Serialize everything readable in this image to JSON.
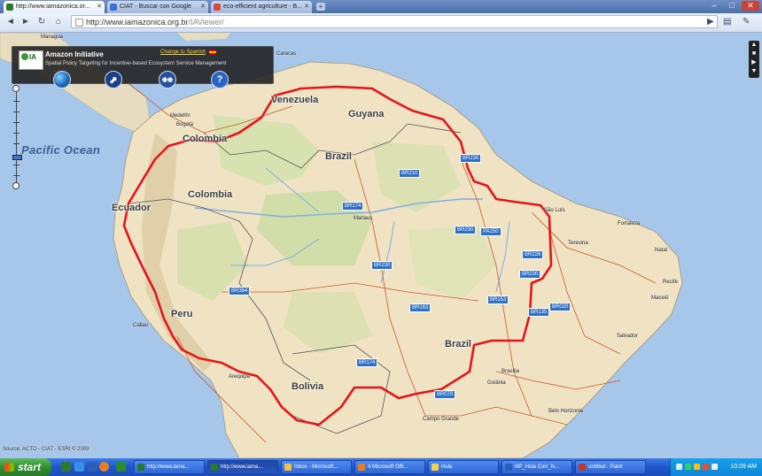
{
  "browser": {
    "tabs": [
      {
        "label": "http://www.iamazonica.or...",
        "active": true,
        "favicon_color": "#2a7a2a"
      },
      {
        "label": "CIAT - Buscar con Google",
        "active": false,
        "favicon_color": "#3b6fd8"
      },
      {
        "label": "eco-efficient agriculture - B...",
        "active": false,
        "favicon_color": "#d84a3b"
      }
    ],
    "new_tab": "+",
    "url_host": "http://www.iamazonica.org.br",
    "url_path": "/IAViewer/",
    "buttons": {
      "back": "◄",
      "forward": "►",
      "reload": "↻",
      "home": "⌂"
    }
  },
  "panel": {
    "title": "Amazon Initiative",
    "subtitle": "Spatial Policy Targeting for Incentive-based Ecosystem Service Management",
    "language_link": "Change to Spanish",
    "logo_text": "IA",
    "buttons": [
      {
        "name": "globe-icon",
        "glyph": "",
        "color": "#2b7fd3"
      },
      {
        "name": "compass-icon",
        "glyph": "⬈",
        "color": "#1b3f8a"
      },
      {
        "name": "binoculars-icon",
        "glyph": "◉◉",
        "color": "#264f9e"
      },
      {
        "name": "help-icon",
        "glyph": "?",
        "color": "#2b64c8"
      }
    ]
  },
  "map": {
    "ocean": "Pacific Ocean",
    "countries": [
      {
        "id": "venezuela",
        "label": "Venezuela"
      },
      {
        "id": "guyana",
        "label": "Guyana"
      },
      {
        "id": "colombia-top",
        "label": "Colombia"
      },
      {
        "id": "colombia-mid",
        "label": "Colombia"
      },
      {
        "id": "brazil-north",
        "label": "Brazil"
      },
      {
        "id": "ecuador",
        "label": "Ecuador"
      },
      {
        "id": "peru",
        "label": "Peru"
      },
      {
        "id": "brazil-south",
        "label": "Brazil"
      },
      {
        "id": "bolivia",
        "label": "Bolivia"
      }
    ],
    "cities": [
      "Managua",
      "Caracas",
      "Medellín",
      "Bogotá",
      "Manaus",
      "São Luís",
      "Fortaleza",
      "Teresina",
      "Natal",
      "Recife",
      "Maceió",
      "Salvador",
      "Brasília",
      "Goiânia",
      "Belo Horizonte",
      "Campo Grande",
      "Arequipa",
      "Callao"
    ],
    "highways": [
      "BR210",
      "BR174",
      "BR230",
      "BR230",
      "PA150",
      "BR230",
      "BR364",
      "BR163",
      "BR153",
      "BR226",
      "BR230",
      "BR135",
      "BR020",
      "BR174",
      "BR070"
    ],
    "source": "Source: ACTO - CIAT - ESRI © 2009",
    "boundary_color": "#e8141b"
  },
  "taskbar": {
    "start": "start",
    "items": [
      {
        "label": "http://www.iama...",
        "active": false,
        "color": "#2a7a2a"
      },
      {
        "label": "http://www.iama...",
        "active": true,
        "color": "#2a7a2a"
      },
      {
        "label": "Inbox - Microsoft...",
        "active": false,
        "color": "#f0c040"
      },
      {
        "label": "4 Microsoft Offi...",
        "active": false,
        "color": "#e67e22"
      },
      {
        "label": "Hula",
        "active": false,
        "color": "#f2d04a"
      },
      {
        "label": "NP_Hula Corr_N...",
        "active": false,
        "color": "#2b5fb8"
      },
      {
        "label": "untitled - Paint",
        "active": false,
        "color": "#c0392b"
      }
    ],
    "clock": "10:09 AM"
  }
}
